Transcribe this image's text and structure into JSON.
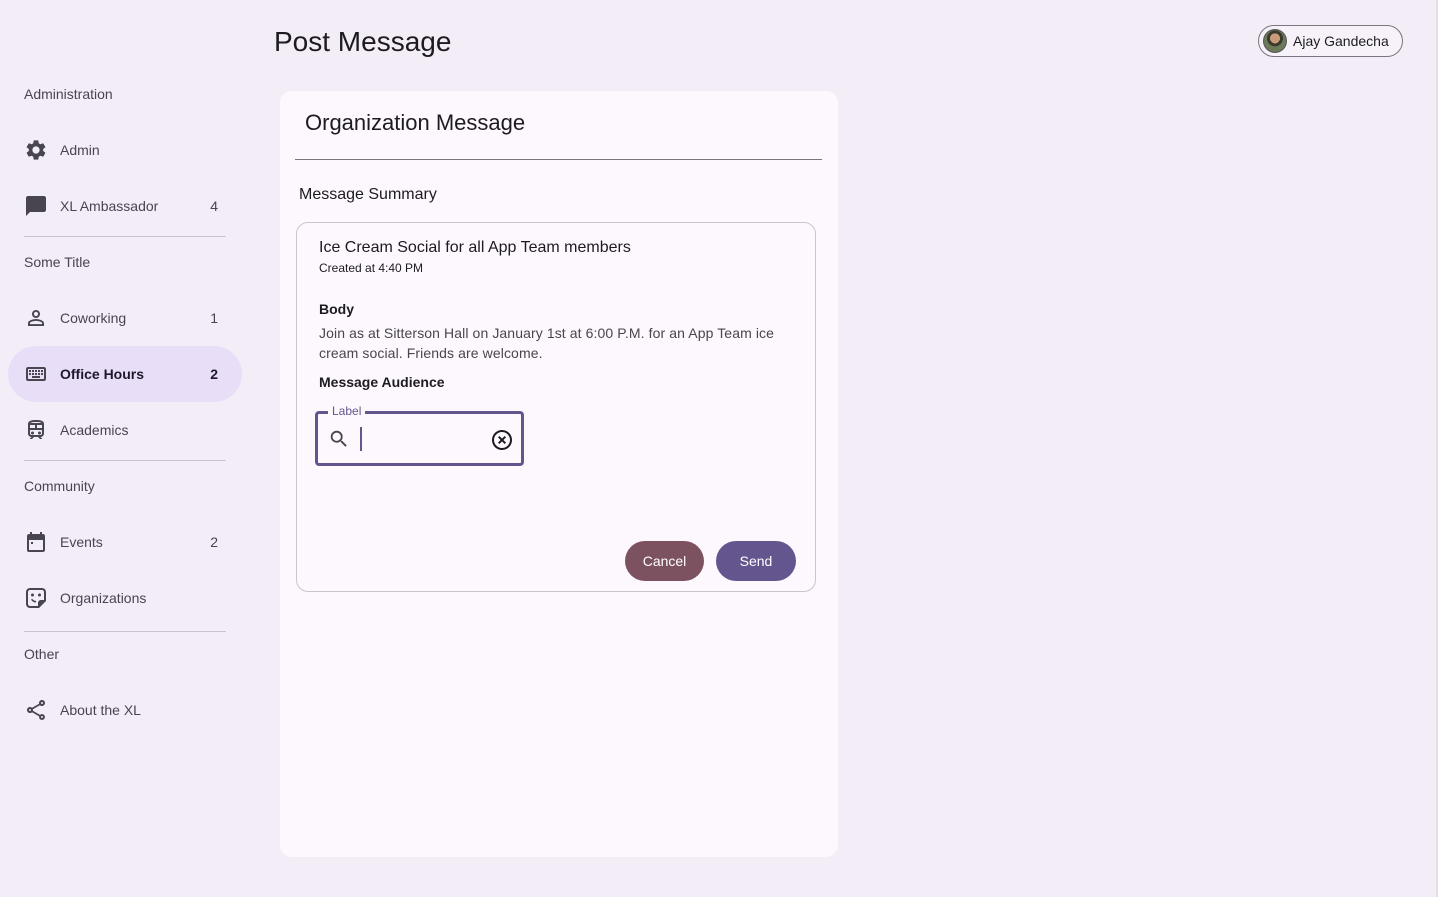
{
  "header": {
    "page_title": "Post Message",
    "profile_name": "Ajay Gandecha"
  },
  "sidebar": {
    "sections": [
      {
        "title": "Administration"
      },
      {
        "title": "Some Title"
      },
      {
        "title": "Community"
      },
      {
        "title": "Other"
      }
    ],
    "items": [
      {
        "label": "Admin",
        "icon": "gear-icon",
        "badge": ""
      },
      {
        "label": "XL Ambassador",
        "icon": "chat-icon",
        "badge": "4"
      },
      {
        "label": "Coworking",
        "icon": "person-icon",
        "badge": "1"
      },
      {
        "label": "Office Hours",
        "icon": "keyboard-icon",
        "badge": "2",
        "active": true
      },
      {
        "label": "Academics",
        "icon": "bus-icon",
        "badge": ""
      },
      {
        "label": "Events",
        "icon": "calendar-icon",
        "badge": "2"
      },
      {
        "label": "Organizations",
        "icon": "sticker-icon",
        "badge": ""
      },
      {
        "label": "About the XL",
        "icon": "share-icon",
        "badge": ""
      }
    ]
  },
  "card": {
    "title": "Organization Message",
    "summary_title": "Message Summary",
    "message": {
      "title": "Ice Cream Social for all App Team members",
      "created": "Created at 4:40 PM",
      "body_heading": "Body",
      "body_text": "Join as at Sitterson Hall on January 1st at 6:00 P.M. for an App Team ice cream social. Friends are welcome.",
      "audience_heading": "Message Audience"
    },
    "audience_field": {
      "label": "Label",
      "value": "",
      "placeholder": ""
    },
    "buttons": {
      "cancel": "Cancel",
      "send": "Send"
    }
  },
  "colors": {
    "background": "#f3edf7",
    "active_nav": "#e8def8",
    "primary": "#65558f",
    "cancel": "#7d5260"
  }
}
